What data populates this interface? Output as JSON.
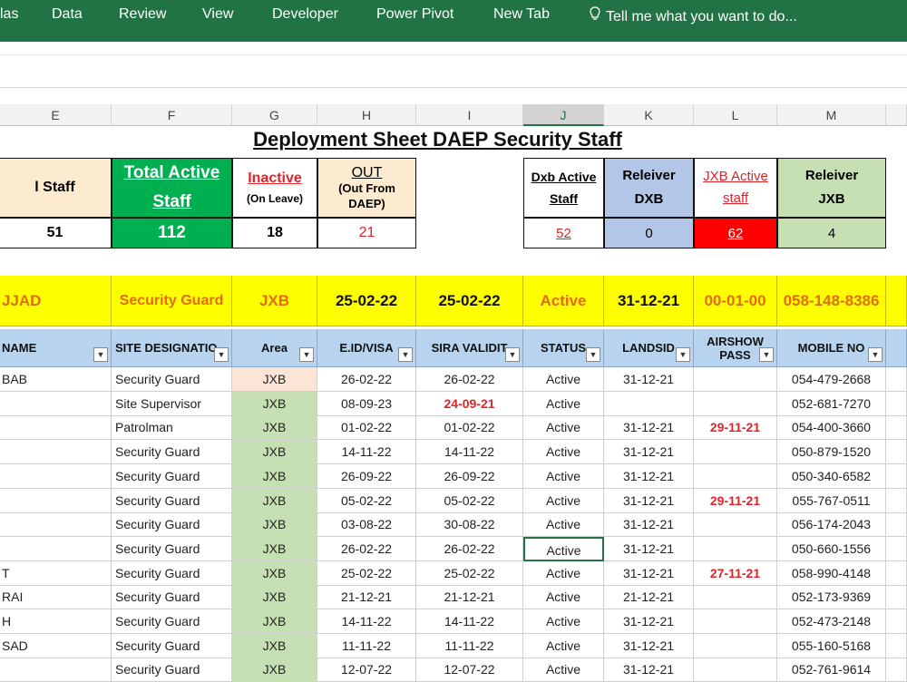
{
  "ribbon": {
    "tabs": [
      "las",
      "Data",
      "Review",
      "View",
      "Developer",
      "Power Pivot",
      "New Tab"
    ],
    "tell_me": "Tell me what you want to do..."
  },
  "columns": [
    "E",
    "F",
    "G",
    "H",
    "I",
    "J",
    "K",
    "L",
    "M"
  ],
  "sheet": {
    "title": "Deployment Sheet DAEP Security Staff",
    "summary": {
      "total_staff_label": "l Staff",
      "total_staff_value": "51",
      "total_active_label_1": "Total Active",
      "total_active_label_2": "Staff",
      "total_active_value": "112",
      "inactive_label": "Inactive",
      "inactive_sub": "(On Leave)",
      "inactive_value": "18",
      "out_label": "OUT",
      "out_sub": "(Out From DAEP)",
      "out_value": "21",
      "dxb_active_label_1": "Dxb Active",
      "dxb_active_label_2": "Staff",
      "dxb_active_value": "52",
      "releiver_dxb_label_1": "Releiver",
      "releiver_dxb_label_2": "DXB",
      "releiver_dxb_value": "0",
      "jxb_active_label_1": "JXB Active",
      "jxb_active_label_2": "staff",
      "jxb_active_value": "62",
      "releiver_jxb_label_1": "Releiver",
      "releiver_jxb_label_2": "JXB",
      "releiver_jxb_value": "4"
    },
    "highlight_row": [
      "JJAD",
      "Security Guard",
      "JXB",
      "25-02-22",
      "25-02-22",
      "Active",
      "31-12-21",
      "00-01-00",
      "058-148-8386"
    ],
    "headers": [
      "NAME",
      "SITE DESIGNATIO",
      "Area",
      "E.ID/VISA",
      "SIRA VALIDIT",
      "STATUS",
      "LANDSID",
      "AIRSHOW PASS",
      "MOBILE NO"
    ],
    "rows": [
      [
        "BAB",
        "Security Guard",
        "JXB",
        "26-02-22",
        "26-02-22",
        "Active",
        "31-12-21",
        "",
        "054-479-2668"
      ],
      [
        "",
        "Site Supervisor",
        "JXB",
        "08-09-23",
        "24-09-21",
        "Active",
        "",
        "",
        "052-681-7270"
      ],
      [
        "",
        "Patrolman",
        "JXB",
        "01-02-22",
        "01-02-22",
        "Active",
        "31-12-21",
        "29-11-21",
        "054-400-3660"
      ],
      [
        "",
        "Security Guard",
        "JXB",
        "14-11-22",
        "14-11-22",
        "Active",
        "31-12-21",
        "",
        "050-879-1520"
      ],
      [
        "",
        "Security Guard",
        "JXB",
        "26-09-22",
        "26-09-22",
        "Active",
        "31-12-21",
        "",
        "050-340-6582"
      ],
      [
        "",
        "Security Guard",
        "JXB",
        "05-02-22",
        "05-02-22",
        "Active",
        "31-12-21",
        "29-11-21",
        "055-767-0511"
      ],
      [
        "",
        "Security Guard",
        "JXB",
        "03-08-22",
        "30-08-22",
        "Active",
        "31-12-21",
        "",
        "056-174-2043"
      ],
      [
        "",
        "Security Guard",
        "JXB",
        "26-02-22",
        "26-02-22",
        "Active",
        "31-12-21",
        "",
        "050-660-1556"
      ],
      [
        "T",
        "Security Guard",
        "JXB",
        "25-02-22",
        "25-02-22",
        "Active",
        "31-12-21",
        "27-11-21",
        "058-990-4148"
      ],
      [
        "RAI",
        "Security Guard",
        "JXB",
        "21-12-21",
        "21-12-21",
        "Active",
        "21-12-21",
        "",
        "052-173-9369"
      ],
      [
        "H",
        "Security Guard",
        "JXB",
        "14-11-22",
        "14-11-22",
        "Active",
        "31-12-21",
        "",
        "052-473-2148"
      ],
      [
        "SAD",
        "Security Guard",
        "JXB",
        "11-11-22",
        "11-11-22",
        "Active",
        "31-12-21",
        "",
        "055-160-5168"
      ],
      [
        "",
        "Security Guard",
        "JXB",
        "12-07-22",
        "12-07-22",
        "Active",
        "31-12-21",
        "",
        "052-761-9614"
      ]
    ]
  },
  "colors": {
    "ribbon": "#217346",
    "total_active_fill": "#00b050",
    "summary_fill": "#fdebd0",
    "header_fill": "#b7d3ee",
    "highlight_fill": "#ffff00",
    "area_fill": "#c6e0b4",
    "red_text": "#e0242a",
    "orange_text": "#e26b0a"
  }
}
